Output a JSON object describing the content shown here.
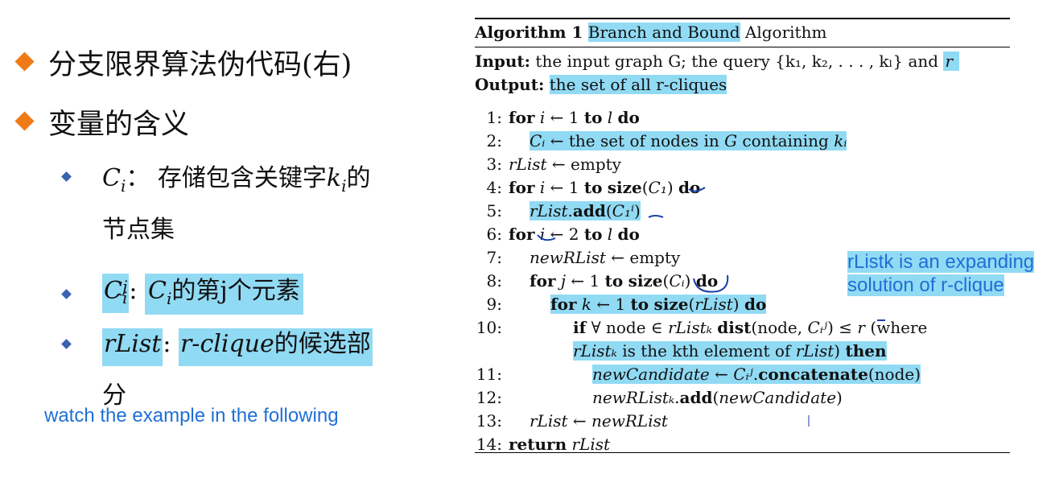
{
  "left": {
    "bullet1": "分支限界算法伪代码(右)",
    "bullet2": "变量的含义",
    "items": [
      {
        "symbol": "C",
        "sub": "i",
        "colon": "：",
        "desc": "存储包含关键字",
        "kvar": "k",
        "ksub": "i",
        "desc2": "的",
        "cont": "节点集"
      },
      {
        "symbol": "C",
        "sub": "i",
        "sup": "j",
        "colon": ":",
        "ref": "C",
        "refsub": "i",
        "desc": "的第j个元素"
      },
      {
        "symbol": "rList",
        "colon": ":",
        "ref": "r-clique",
        "desc": "的候选部",
        "cont": "分"
      }
    ],
    "note": "watch the example in the following"
  },
  "annotation": {
    "line1": "rListk is an expanding",
    "line2": "solution of r-clique"
  },
  "algorithm": {
    "title_bold": "Algorithm 1",
    "title_hl": "Branch and Bound",
    "title_rest": "Algorithm",
    "input_label": "Input:",
    "input_text": "the input graph G; the query {k₁, k₂, . . . , kₗ} and",
    "input_r": "r",
    "output_label": "Output:",
    "output_text": "the set of all r-cliques",
    "lines": [
      {
        "n": "1:",
        "html": "for i ← 1 to l do"
      },
      {
        "n": "2:",
        "html": "Cᵢ ← the set of nodes in G containing kᵢ"
      },
      {
        "n": "3:",
        "html": "rList ← empty"
      },
      {
        "n": "4:",
        "html": "for i ← 1 to size(C₁) do"
      },
      {
        "n": "5:",
        "html": "rList.add(C₁ⁱ)"
      },
      {
        "n": "6:",
        "html": "for i ← 2 to l do"
      },
      {
        "n": "7:",
        "html": "newRList ← empty"
      },
      {
        "n": "8:",
        "html": "for j ← 1 to size(Cᵢ) do"
      },
      {
        "n": "9:",
        "html": "for k ← 1 to size(rList) do"
      },
      {
        "n": "10:",
        "html": "if ∀ node ∈ rListₖ dist(node, Cᵢʲ) ≤ r (where"
      },
      {
        "n": "",
        "html": "rListₖ is the kth element of rList) then"
      },
      {
        "n": "11:",
        "html": "newCandidate ← Cᵢʲ.concatenate(node)"
      },
      {
        "n": "12:",
        "html": "newRListₖ.add(newCandidate)"
      },
      {
        "n": "13:",
        "html": "rList ← newRList"
      },
      {
        "n": "14:",
        "html": "return rList"
      }
    ]
  }
}
